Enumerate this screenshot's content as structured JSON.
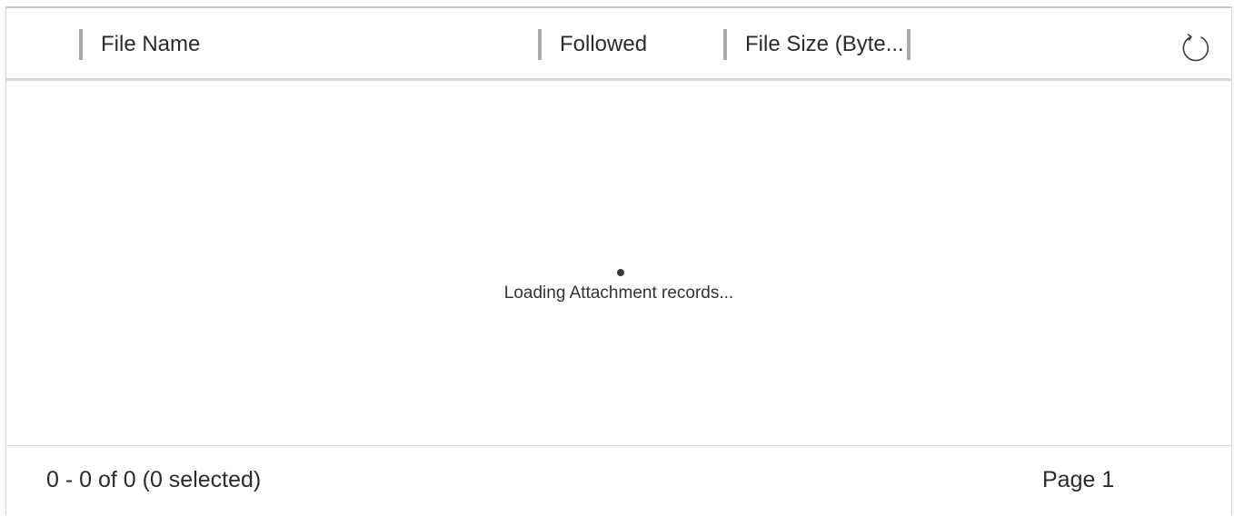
{
  "grid": {
    "columns": [
      {
        "label": "File Name"
      },
      {
        "label": "Followed"
      },
      {
        "label": "File Size (Byte..."
      }
    ],
    "refresh_icon": "refresh-icon",
    "loading_text": "Loading Attachment records...",
    "footer": {
      "count_text": "0 - 0 of 0 (0 selected)",
      "page_text": "Page 1"
    }
  }
}
